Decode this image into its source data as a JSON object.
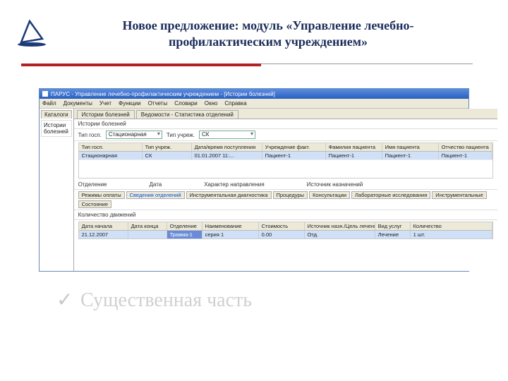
{
  "slide": {
    "title": "Новое предложение: модуль «Управление лечебно-профилактическим учреждением»",
    "watermark": "Существенная часть"
  },
  "app": {
    "title": "ПАРУС - Управление лечебно-профилактическим учреждением - [Истории болезней]",
    "menu": [
      "Файл",
      "Документы",
      "Учет",
      "Функции",
      "Отчеты",
      "Словари",
      "Окно",
      "Справка"
    ],
    "side_tab": "Каталоги",
    "side_item": "Истории болезней",
    "main_tabs": [
      "Истории болезней",
      "Ведомости - Статистика отделений"
    ],
    "filter_label": "Истории болезней",
    "combo1_label": "Тип госп.",
    "combo1_value": "Стационарная",
    "combo2_label": "Тип учреж.",
    "combo2_value": "СК",
    "g1_headers": [
      "Тип госп.",
      "Тип учреж.",
      "Дата/время поступления",
      "Учреждение факт.",
      "Фамилия пациента",
      "Имя пациента",
      "Отчество пациента"
    ],
    "g1_row": [
      "Стационарная",
      "СК",
      "01.01.2007 11:...",
      "Пациент-1",
      "Пациент-1",
      "Пациент-1",
      "Пациент-1"
    ],
    "info_labels": [
      "Отделение",
      "Дата",
      "Характер направления",
      "Источник назначений"
    ],
    "subtabs": [
      "Режимы оплаты",
      "Сведения отделений",
      "Инструментальная диагностика",
      "Процедуры",
      "Консультации",
      "Лабораторные исследования",
      "Инструментальные",
      "Состояние"
    ],
    "list_label": "Количество движений",
    "g2_headers": [
      "Дата начала",
      "Дата конца",
      "Отделение",
      "Наименование",
      "Стоимость",
      "Источник назн./Цель лечения",
      "Вид услуг",
      "Количество"
    ],
    "g2_row": [
      "21.12.2007",
      "",
      "Травма-1",
      "серия 1",
      "0.00",
      "Отд.",
      "Лечение",
      "1 шт."
    ]
  }
}
